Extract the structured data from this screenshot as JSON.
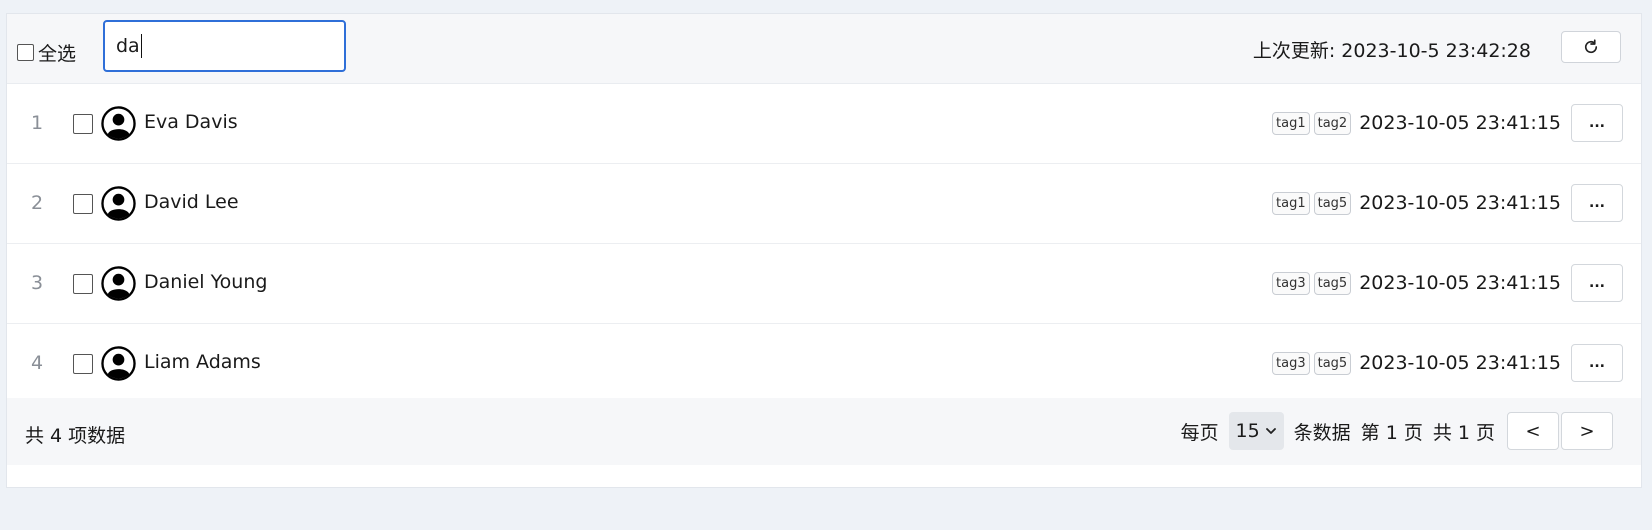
{
  "toolbar": {
    "select_all_label": "全选",
    "search_value": "da",
    "last_updated": "上次更新: 2023-10-5 23:42:28",
    "refresh_icon": "refresh-icon"
  },
  "rows": [
    {
      "index": "1",
      "name": "Eva Davis",
      "tags": [
        "tag1",
        "tag2"
      ],
      "date": "2023-10-05 23:41:15",
      "more": "..."
    },
    {
      "index": "2",
      "name": "David Lee",
      "tags": [
        "tag1",
        "tag5"
      ],
      "date": "2023-10-05 23:41:15",
      "more": "..."
    },
    {
      "index": "3",
      "name": "Daniel Young",
      "tags": [
        "tag3",
        "tag5"
      ],
      "date": "2023-10-05 23:41:15",
      "more": "..."
    },
    {
      "index": "4",
      "name": "Liam Adams",
      "tags": [
        "tag3",
        "tag5"
      ],
      "date": "2023-10-05 23:41:15",
      "more": "..."
    }
  ],
  "footer": {
    "total": "共 4 项数据",
    "per_page_label": "每页",
    "page_size": "15",
    "per_page_suffix": "条数据",
    "current_page": "第 1 页",
    "total_pages": "共 1 页",
    "prev": "<",
    "next": ">"
  },
  "colors": {
    "accent": "#2f6fd8",
    "page_bg": "#eef2f7"
  }
}
